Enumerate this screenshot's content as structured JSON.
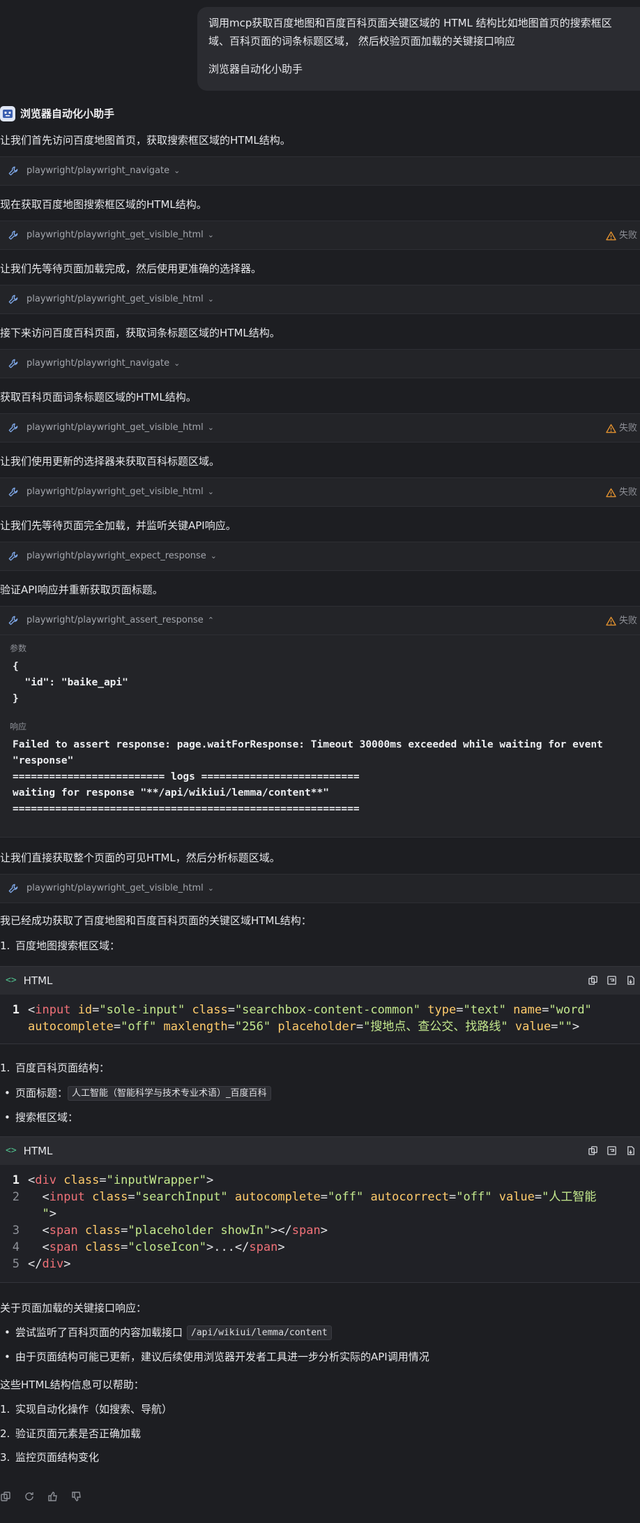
{
  "user_message": {
    "text": "调用mcp获取百度地图和百度百科页面关键区域的 HTML 结构比如地图首页的搜索框区域、百科页面的词条标题区域， 然后校验页面加载的关键接口响应",
    "signature": "浏览器自动化小助手"
  },
  "assistant": {
    "name": "浏览器自动化小助手"
  },
  "steps": [
    {
      "text": "让我们首先访问百度地图首页，获取搜索框区域的HTML结构。",
      "tool": "playwright/playwright_navigate",
      "failed": false
    },
    {
      "text": "现在获取百度地图搜索框区域的HTML结构。",
      "tool": "playwright/playwright_get_visible_html",
      "failed": true
    },
    {
      "text": "让我们先等待页面加载完成，然后使用更准确的选择器。",
      "tool": "playwright/playwright_get_visible_html",
      "failed": false
    },
    {
      "text": "接下来访问百度百科页面，获取词条标题区域的HTML结构。",
      "tool": "playwright/playwright_navigate",
      "failed": false
    },
    {
      "text": "获取百科页面词条标题区域的HTML结构。",
      "tool": "playwright/playwright_get_visible_html",
      "failed": true
    },
    {
      "text": "让我们使用更新的选择器来获取百科标题区域。",
      "tool": "playwright/playwright_get_visible_html",
      "failed": true
    },
    {
      "text": "让我们先等待页面完全加载，并监听关键API响应。",
      "tool": "playwright/playwright_expect_response",
      "failed": false
    },
    {
      "text": "验证API响应并重新获取页面标题。",
      "tool": "playwright/playwright_assert_response",
      "failed": true
    },
    {
      "text": "让我们直接获取整个页面的可见HTML，然后分析标题区域。",
      "tool": "playwright/playwright_get_visible_html",
      "failed": false
    }
  ],
  "fail_label": "失败",
  "expanded": {
    "params_label": "参数",
    "params_code": "{\n  \"id\": \"baike_api\"\n}",
    "response_label": "响应",
    "response_code": "Failed to assert response: page.waitForResponse: Timeout 30000ms exceeded while waiting for event\n\"response\"\n========================= logs ==========================\nwaiting for response \"**/api/wikiui/lemma/content**\"\n========================================================="
  },
  "summary": {
    "intro": "我已经成功获取了百度地图和百度百科页面的关键区域HTML结构：",
    "item1_num": "1.",
    "item1": "百度地图搜索框区域：",
    "code_lang": "HTML",
    "item2_num": "1.",
    "item2": "百度百科页面结构：",
    "page_title_label": "页面标题：",
    "page_title_value": "人工智能（智能科学与技术专业术语）_百度百科",
    "searchbox_label": "搜索框区域：",
    "api_intro": "关于页面加载的关键接口响应：",
    "api_item1_pre": "尝试监听了百科页面的内容加载接口",
    "api_item1_code": "/api/wikiui/lemma/content",
    "api_item2": "由于页面结构可能已更新，建议后续使用浏览器开发者工具进一步分析实际的API调用情况",
    "help_intro": "这些HTML结构信息可以帮助：",
    "help_items": [
      {
        "num": "1.",
        "text": "实现自动化操作（如搜索、导航）"
      },
      {
        "num": "2.",
        "text": "验证页面元素是否正确加载"
      },
      {
        "num": "3.",
        "text": "监控页面结构变化"
      }
    ]
  },
  "code1": {
    "line_numbers": [
      "1"
    ],
    "l1_a": "<",
    "l1_tag": "input",
    "l1_sp1": " ",
    "l1_at1": "id",
    "l1_eq1": "=",
    "l1_v1": "\"sole-input\"",
    "l1_sp2": " ",
    "l1_at2": "class",
    "l1_eq2": "=",
    "l1_v2": "\"searchbox-content-common\"",
    "l1_sp3": " ",
    "l1_at3": "type",
    "l1_eq3": "=",
    "l1_v3": "\"text\"",
    "l1_sp4": " ",
    "l1_at4": "name",
    "l1_eq4": "=",
    "l1_v4": "\"word\"",
    "l1_sp5": "\n",
    "l1_at5": "autocomplete",
    "l1_eq5": "=",
    "l1_v5": "\"off\"",
    "l1_sp6": " ",
    "l1_at6": "maxlength",
    "l1_eq6": "=",
    "l1_v6": "\"256\"",
    "l1_sp7": " ",
    "l1_at7": "placeholder",
    "l1_eq7": "=",
    "l1_v7": "\"搜地点、查公交、找路线\"",
    "l1_sp8": " ",
    "l1_at8": "value",
    "l1_eq8": "=",
    "l1_v8": "\"\"",
    "l1_end": ">"
  },
  "code2": {
    "line_numbers": [
      "1",
      "2",
      "3",
      "4",
      "5"
    ],
    "lines": [
      [
        [
          "pn",
          "<"
        ],
        [
          "tg",
          "div"
        ],
        [
          "pn",
          " "
        ],
        [
          "at",
          "class"
        ],
        [
          "pn",
          "="
        ],
        [
          "st",
          "\"inputWrapper\""
        ],
        [
          "pn",
          ">"
        ]
      ],
      [
        [
          "pn",
          "  <"
        ],
        [
          "tg",
          "input"
        ],
        [
          "pn",
          " "
        ],
        [
          "at",
          "class"
        ],
        [
          "pn",
          "="
        ],
        [
          "st",
          "\"searchInput\""
        ],
        [
          "pn",
          " "
        ],
        [
          "at",
          "autocomplete"
        ],
        [
          "pn",
          "="
        ],
        [
          "st",
          "\"off\""
        ],
        [
          "pn",
          " "
        ],
        [
          "at",
          "autocorrect"
        ],
        [
          "pn",
          "="
        ],
        [
          "st",
          "\"off\""
        ],
        [
          "pn",
          " "
        ],
        [
          "at",
          "value"
        ],
        [
          "pn",
          "="
        ],
        [
          "st",
          "\"人工智能\n  \""
        ],
        [
          "pn",
          ">"
        ]
      ],
      [
        [
          "pn",
          "  <"
        ],
        [
          "tg",
          "span"
        ],
        [
          "pn",
          " "
        ],
        [
          "at",
          "class"
        ],
        [
          "pn",
          "="
        ],
        [
          "st",
          "\"placeholder showIn\""
        ],
        [
          "pn",
          "></"
        ],
        [
          "tg",
          "span"
        ],
        [
          "pn",
          ">"
        ]
      ],
      [
        [
          "pn",
          "  <"
        ],
        [
          "tg",
          "span"
        ],
        [
          "pn",
          " "
        ],
        [
          "at",
          "class"
        ],
        [
          "pn",
          "="
        ],
        [
          "st",
          "\"closeIcon\""
        ],
        [
          "pn",
          ">...</"
        ],
        [
          "tg",
          "span"
        ],
        [
          "pn",
          ">"
        ]
      ],
      [
        [
          "pn",
          "</"
        ],
        [
          "tg",
          "div"
        ],
        [
          "pn",
          ">"
        ]
      ]
    ]
  },
  "colors": {
    "bg": "#1d1e22",
    "panel": "#232428",
    "warn": "#e0902f",
    "accent": "#4fc08d",
    "tag": "#f07178",
    "attr": "#ffcb6b",
    "string": "#c3e88d"
  },
  "icons": [
    "bot-icon",
    "wrench-icon",
    "chevron-down-icon",
    "chevron-up-icon",
    "warning-icon",
    "copy-icon",
    "wrap-icon",
    "download-icon",
    "refresh-icon",
    "thumbs-up-icon",
    "thumbs-down-icon"
  ]
}
